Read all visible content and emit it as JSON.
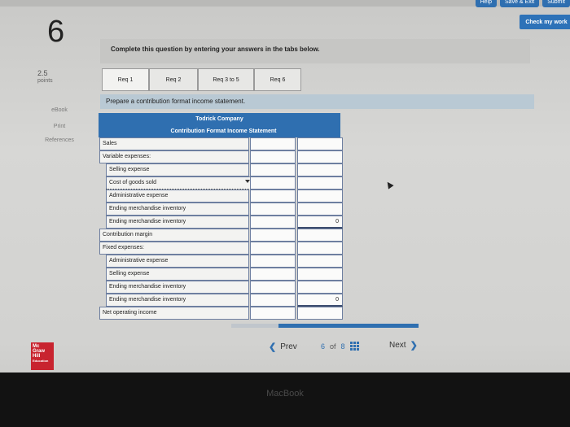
{
  "top_buttons": [
    "Help",
    "Save & Exit",
    "Submit"
  ],
  "check_button": "Check my work",
  "question_number": "6",
  "points": {
    "value": "2.5",
    "label": "points"
  },
  "side_links": [
    "eBook",
    "Print",
    "References"
  ],
  "instruction": "Complete this question by entering your answers in the tabs below.",
  "tabs": [
    "Req 1",
    "Req 2",
    "Req 3 to 5",
    "Req 6"
  ],
  "prompt": "Prepare a contribution format income statement.",
  "sheet": {
    "company": "Todrick Company",
    "title": "Contribution Format Income Statement",
    "rows": [
      {
        "label": "Sales",
        "value": ""
      },
      {
        "label": "Variable expenses:",
        "value": ""
      },
      {
        "label": "Selling expense",
        "value": ""
      },
      {
        "label": "Cost of goods sold",
        "value": ""
      },
      {
        "label": "Administrative expense",
        "value": ""
      },
      {
        "label": "Ending merchandise inventory",
        "value": ""
      },
      {
        "label": "Ending merchandise inventory",
        "value": "0"
      },
      {
        "label": "Contribution margin",
        "value": ""
      },
      {
        "label": "Fixed expenses:",
        "value": ""
      },
      {
        "label": "Administrative expense",
        "value": ""
      },
      {
        "label": "Selling expense",
        "value": ""
      },
      {
        "label": "Ending merchandise inventory",
        "value": ""
      },
      {
        "label": "Ending merchandise inventory",
        "value": "0"
      },
      {
        "label": "Net operating income",
        "value": ""
      }
    ]
  },
  "logo_text": [
    "Mc",
    "Graw",
    "Hill",
    "Education"
  ],
  "nav": {
    "prev": "Prev",
    "page_current": "6",
    "page_of": "of",
    "page_total": "8",
    "next": "Next"
  },
  "progress_fraction": 0.75,
  "laptop_brand": "MacBook"
}
